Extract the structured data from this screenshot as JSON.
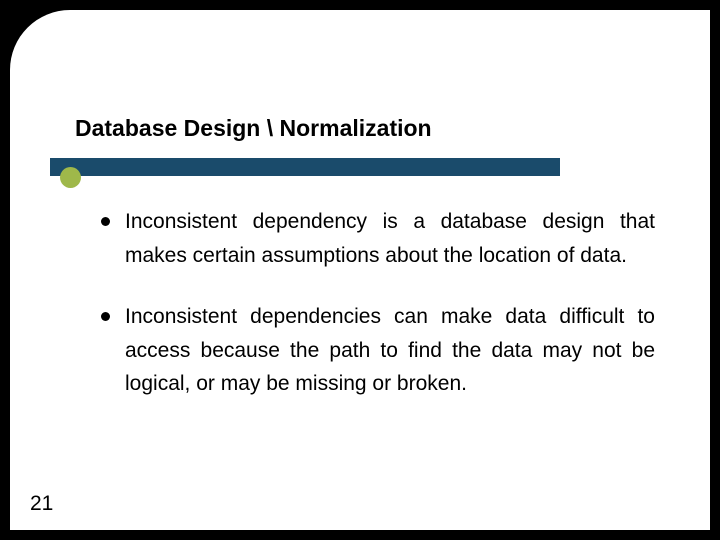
{
  "title": "Database Design \\ Normalization",
  "bullets": [
    "Inconsistent dependency is a database design that makes certain assumptions about the location of data.",
    "Inconsistent dependencies can make data difficult to access because the path to find the data may not be logical, or may be missing or broken."
  ],
  "page_number": "21"
}
